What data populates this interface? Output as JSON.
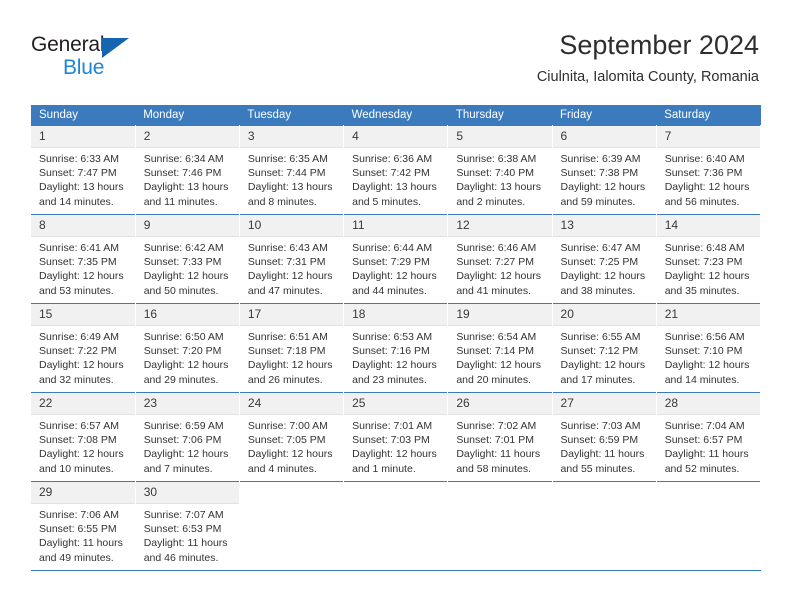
{
  "brand": {
    "name_part1": "General",
    "name_part2": "Blue",
    "triangle_color": "#1565b0",
    "blue_color": "#1e86d8"
  },
  "header": {
    "title": "September 2024",
    "subtitle": "Ciulnita, Ialomita County, Romania"
  },
  "colors": {
    "header_row": "#3a7abd",
    "daynum_bg": "#f1f1f1",
    "text": "#333333"
  },
  "weekday_headers": [
    "Sunday",
    "Monday",
    "Tuesday",
    "Wednesday",
    "Thursday",
    "Friday",
    "Saturday"
  ],
  "weeks": [
    [
      {
        "day": "1",
        "sunrise": "Sunrise: 6:33 AM",
        "sunset": "Sunset: 7:47 PM",
        "daylight": "Daylight: 13 hours and 14 minutes."
      },
      {
        "day": "2",
        "sunrise": "Sunrise: 6:34 AM",
        "sunset": "Sunset: 7:46 PM",
        "daylight": "Daylight: 13 hours and 11 minutes."
      },
      {
        "day": "3",
        "sunrise": "Sunrise: 6:35 AM",
        "sunset": "Sunset: 7:44 PM",
        "daylight": "Daylight: 13 hours and 8 minutes."
      },
      {
        "day": "4",
        "sunrise": "Sunrise: 6:36 AM",
        "sunset": "Sunset: 7:42 PM",
        "daylight": "Daylight: 13 hours and 5 minutes."
      },
      {
        "day": "5",
        "sunrise": "Sunrise: 6:38 AM",
        "sunset": "Sunset: 7:40 PM",
        "daylight": "Daylight: 13 hours and 2 minutes."
      },
      {
        "day": "6",
        "sunrise": "Sunrise: 6:39 AM",
        "sunset": "Sunset: 7:38 PM",
        "daylight": "Daylight: 12 hours and 59 minutes."
      },
      {
        "day": "7",
        "sunrise": "Sunrise: 6:40 AM",
        "sunset": "Sunset: 7:36 PM",
        "daylight": "Daylight: 12 hours and 56 minutes."
      }
    ],
    [
      {
        "day": "8",
        "sunrise": "Sunrise: 6:41 AM",
        "sunset": "Sunset: 7:35 PM",
        "daylight": "Daylight: 12 hours and 53 minutes."
      },
      {
        "day": "9",
        "sunrise": "Sunrise: 6:42 AM",
        "sunset": "Sunset: 7:33 PM",
        "daylight": "Daylight: 12 hours and 50 minutes."
      },
      {
        "day": "10",
        "sunrise": "Sunrise: 6:43 AM",
        "sunset": "Sunset: 7:31 PM",
        "daylight": "Daylight: 12 hours and 47 minutes."
      },
      {
        "day": "11",
        "sunrise": "Sunrise: 6:44 AM",
        "sunset": "Sunset: 7:29 PM",
        "daylight": "Daylight: 12 hours and 44 minutes."
      },
      {
        "day": "12",
        "sunrise": "Sunrise: 6:46 AM",
        "sunset": "Sunset: 7:27 PM",
        "daylight": "Daylight: 12 hours and 41 minutes."
      },
      {
        "day": "13",
        "sunrise": "Sunrise: 6:47 AM",
        "sunset": "Sunset: 7:25 PM",
        "daylight": "Daylight: 12 hours and 38 minutes."
      },
      {
        "day": "14",
        "sunrise": "Sunrise: 6:48 AM",
        "sunset": "Sunset: 7:23 PM",
        "daylight": "Daylight: 12 hours and 35 minutes."
      }
    ],
    [
      {
        "day": "15",
        "sunrise": "Sunrise: 6:49 AM",
        "sunset": "Sunset: 7:22 PM",
        "daylight": "Daylight: 12 hours and 32 minutes."
      },
      {
        "day": "16",
        "sunrise": "Sunrise: 6:50 AM",
        "sunset": "Sunset: 7:20 PM",
        "daylight": "Daylight: 12 hours and 29 minutes."
      },
      {
        "day": "17",
        "sunrise": "Sunrise: 6:51 AM",
        "sunset": "Sunset: 7:18 PM",
        "daylight": "Daylight: 12 hours and 26 minutes."
      },
      {
        "day": "18",
        "sunrise": "Sunrise: 6:53 AM",
        "sunset": "Sunset: 7:16 PM",
        "daylight": "Daylight: 12 hours and 23 minutes."
      },
      {
        "day": "19",
        "sunrise": "Sunrise: 6:54 AM",
        "sunset": "Sunset: 7:14 PM",
        "daylight": "Daylight: 12 hours and 20 minutes."
      },
      {
        "day": "20",
        "sunrise": "Sunrise: 6:55 AM",
        "sunset": "Sunset: 7:12 PM",
        "daylight": "Daylight: 12 hours and 17 minutes."
      },
      {
        "day": "21",
        "sunrise": "Sunrise: 6:56 AM",
        "sunset": "Sunset: 7:10 PM",
        "daylight": "Daylight: 12 hours and 14 minutes."
      }
    ],
    [
      {
        "day": "22",
        "sunrise": "Sunrise: 6:57 AM",
        "sunset": "Sunset: 7:08 PM",
        "daylight": "Daylight: 12 hours and 10 minutes."
      },
      {
        "day": "23",
        "sunrise": "Sunrise: 6:59 AM",
        "sunset": "Sunset: 7:06 PM",
        "daylight": "Daylight: 12 hours and 7 minutes."
      },
      {
        "day": "24",
        "sunrise": "Sunrise: 7:00 AM",
        "sunset": "Sunset: 7:05 PM",
        "daylight": "Daylight: 12 hours and 4 minutes."
      },
      {
        "day": "25",
        "sunrise": "Sunrise: 7:01 AM",
        "sunset": "Sunset: 7:03 PM",
        "daylight": "Daylight: 12 hours and 1 minute."
      },
      {
        "day": "26",
        "sunrise": "Sunrise: 7:02 AM",
        "sunset": "Sunset: 7:01 PM",
        "daylight": "Daylight: 11 hours and 58 minutes."
      },
      {
        "day": "27",
        "sunrise": "Sunrise: 7:03 AM",
        "sunset": "Sunset: 6:59 PM",
        "daylight": "Daylight: 11 hours and 55 minutes."
      },
      {
        "day": "28",
        "sunrise": "Sunrise: 7:04 AM",
        "sunset": "Sunset: 6:57 PM",
        "daylight": "Daylight: 11 hours and 52 minutes."
      }
    ],
    [
      {
        "day": "29",
        "sunrise": "Sunrise: 7:06 AM",
        "sunset": "Sunset: 6:55 PM",
        "daylight": "Daylight: 11 hours and 49 minutes."
      },
      {
        "day": "30",
        "sunrise": "Sunrise: 7:07 AM",
        "sunset": "Sunset: 6:53 PM",
        "daylight": "Daylight: 11 hours and 46 minutes."
      },
      {
        "day": "",
        "sunrise": "",
        "sunset": "",
        "daylight": ""
      },
      {
        "day": "",
        "sunrise": "",
        "sunset": "",
        "daylight": ""
      },
      {
        "day": "",
        "sunrise": "",
        "sunset": "",
        "daylight": ""
      },
      {
        "day": "",
        "sunrise": "",
        "sunset": "",
        "daylight": ""
      },
      {
        "day": "",
        "sunrise": "",
        "sunset": "",
        "daylight": ""
      }
    ]
  ]
}
